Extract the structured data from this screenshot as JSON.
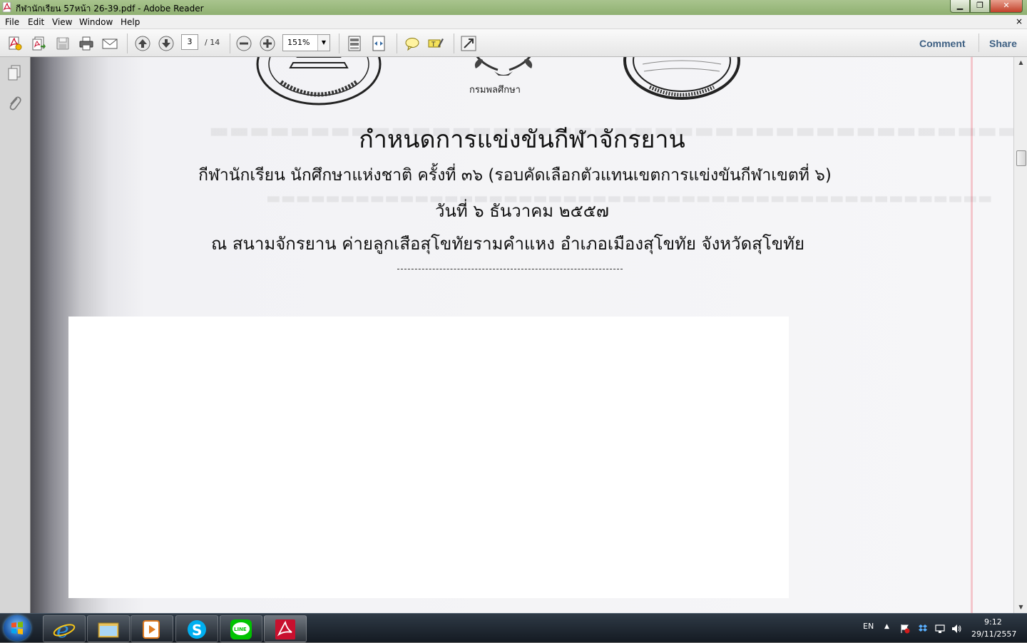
{
  "window": {
    "title": "กีฬานักเรียน 57หน้า 26-39.pdf - Adobe Reader",
    "minimize_label": "▁",
    "restore_label": "❐",
    "close_label": "✕"
  },
  "menu": {
    "items": [
      "File",
      "Edit",
      "View",
      "Window",
      "Help"
    ],
    "doc_close": "×"
  },
  "toolbar": {
    "current_page": "3",
    "total_pages": "/ 14",
    "zoom": "151%",
    "comment_label": "Comment",
    "share_label": "Share"
  },
  "document": {
    "logo_caption": "กรมพลศึกษา",
    "title": "กำหนดการแข่งขันกีฬาจักรยาน",
    "subtitle1": "กีฬานักเรียน นักศึกษาแห่งชาติ ครั้งที่ ๓๖ (รอบคัดเลือกตัวแทนเขตการแข่งขันกีฬาเขตที่ ๖)",
    "subtitle2": "วันที่ ๖ ธันวาคม ๒๕๕๗",
    "subtitle3": "ณ สนามจักรยาน ค่ายลูกเสือสุโขทัยรามคำแหง อำเภอเมืองสุโขทัย จังหวัดสุโขทัย"
  },
  "taskbar": {
    "language": "EN",
    "time": "9:12",
    "date": "29/11/2557"
  },
  "colors": {
    "titlebar": "#9bbb7d",
    "link": "#3d5f82",
    "adobe_red": "#c8102e"
  }
}
